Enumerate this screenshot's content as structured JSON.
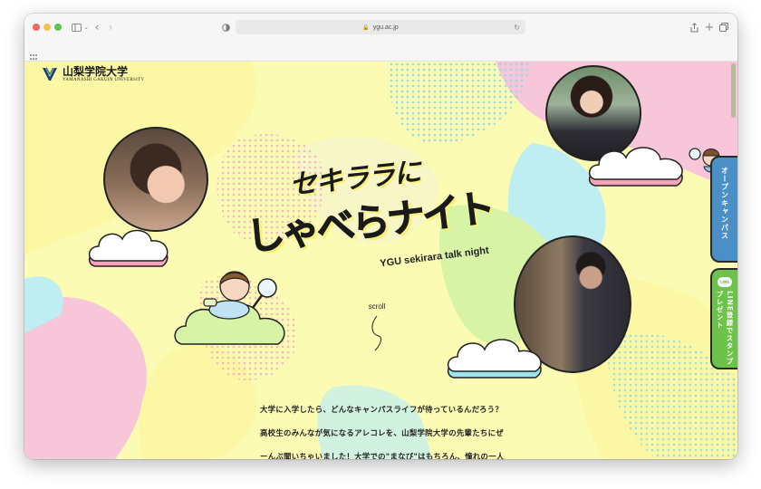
{
  "browser": {
    "url": "ygu.ac.jp"
  },
  "header": {
    "logo_jp": "山梨学院大学",
    "logo_en": "YAMANASHI GAKUIN UNIVERSITY"
  },
  "hero": {
    "title_line1": "セキララに",
    "title_line2": "しゃべらナイト",
    "subtitle": "YGU sekirara talk night",
    "scroll_label": "scroll"
  },
  "side_tabs": {
    "open_campus": "オープンキャンパス",
    "line": "LINE登録でスタンププレゼント",
    "line_icon_text": "LINE"
  },
  "intro": {
    "line1": "大学に入学したら、どんなキャンパスライフが待っているんだろう？",
    "line2": "高校生のみんなが気になるアレコレを、山梨学院大学の先輩たちにぜ",
    "line3": "ーんぶ聞いちゃいました！大学での\"まなび\"はもちろん、憧れの一人"
  },
  "colors": {
    "background": "#fcfbb4",
    "pink": "#f7c6d9",
    "cyan": "#bfeef2",
    "green": "#d6f3a6",
    "open_campus_tab": "#4b8fc7",
    "line_tab": "#6cc24a"
  }
}
